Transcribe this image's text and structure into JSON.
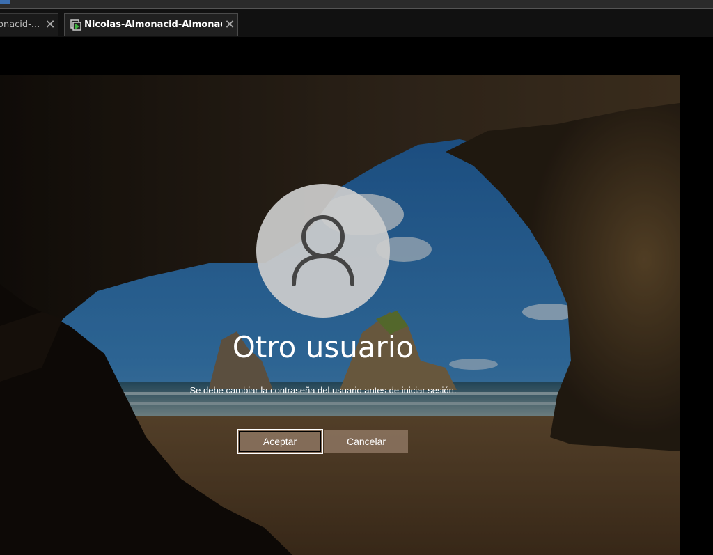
{
  "tabs": [
    {
      "label": "onacid-...",
      "active": false
    },
    {
      "label": "Nicolas-Almonacid-Almonaci...",
      "active": true
    }
  ],
  "tab_close_glyph": "✕",
  "login": {
    "user_name": "Otro usuario",
    "message": "Se debe cambiar la contraseña del usuario antes de iniciar sesión.",
    "accept_label": "Aceptar",
    "cancel_label": "Cancelar",
    "avatar_icon": "user-silhouette-icon"
  },
  "colors": {
    "sky": "#2b6aa8",
    "sand": "#8a6a45",
    "cave": "#2a2018",
    "button": "#96806a"
  }
}
